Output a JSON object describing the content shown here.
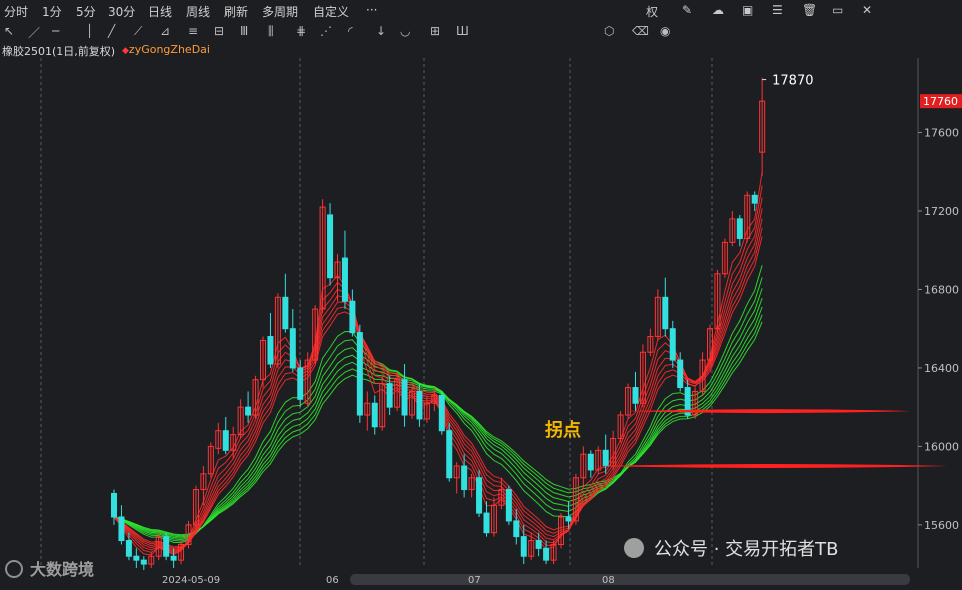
{
  "menu": [
    "分时",
    "1分",
    "5分",
    "30分",
    "日线",
    "周线",
    "刷新",
    "多周期",
    "自定义",
    "···"
  ],
  "right_tools": {
    "quan": "权",
    "icons": [
      "pencil-icon",
      "cloud-download-icon",
      "image-icon",
      "sliders-icon",
      "trash-icon",
      "layout-icon",
      "close-icon"
    ]
  },
  "drawing_tools": [
    "cursor-icon",
    "line-icon",
    "hline-icon",
    "vline-icon",
    "ray-icon",
    "segment-icon",
    "trend-angle-icon",
    "channel-icon",
    "parallel-icon",
    "period-icon",
    "fib-icon",
    "gann-icon",
    "fan-icon",
    "arc-icon",
    "down-arrow-icon",
    "cycle-icon",
    "grid-icon",
    "percent-icon",
    "shape-icon",
    "eraser-icon",
    "eye-icon"
  ],
  "info": {
    "symbol": "橡胶2501(1日,前复权)",
    "indicator": "zyGongZheDai"
  },
  "annotations": {
    "inflection": "拐点",
    "peak_label": "17870"
  },
  "watermark": {
    "left": "大数跨境",
    "right": "公众号 · 交易开拓者TB"
  },
  "colors": {
    "up": "#ff3333",
    "down": "#33e0e0",
    "ribbon_red": "#ff2a2a",
    "ribbon_green": "#33ff33",
    "price_tag": "#e02020",
    "annotation": "#f2b705"
  },
  "chart_data": {
    "type": "candlestick",
    "instrument": "橡胶2501",
    "period": "1日",
    "yticks": [
      15600,
      16000,
      16400,
      16800,
      17200,
      17600
    ],
    "ylim": [
      15380,
      17980
    ],
    "last_price": 17760,
    "high": 17870,
    "xlabels": [
      "2024-05-09",
      "06",
      "07",
      "08"
    ],
    "horizontal_lines": [
      16180,
      15900
    ],
    "candles": [
      [
        15760,
        15780,
        15600,
        15640
      ],
      [
        15640,
        15700,
        15500,
        15520
      ],
      [
        15520,
        15560,
        15420,
        15440
      ],
      [
        15440,
        15480,
        15380,
        15420
      ],
      [
        15420,
        15440,
        15360,
        15400
      ],
      [
        15400,
        15460,
        15380,
        15440
      ],
      [
        15440,
        15560,
        15420,
        15540
      ],
      [
        15540,
        15560,
        15420,
        15440
      ],
      [
        15440,
        15480,
        15380,
        15420
      ],
      [
        15420,
        15520,
        15400,
        15500
      ],
      [
        15500,
        15620,
        15480,
        15600
      ],
      [
        15600,
        15800,
        15580,
        15780
      ],
      [
        15780,
        15900,
        15700,
        15860
      ],
      [
        15860,
        16020,
        15840,
        16000
      ],
      [
        15990,
        16120,
        15960,
        16080
      ],
      [
        16080,
        16150,
        15960,
        15980
      ],
      [
        15980,
        16100,
        15940,
        16060
      ],
      [
        16060,
        16240,
        16040,
        16200
      ],
      [
        16200,
        16280,
        16120,
        16160
      ],
      [
        16160,
        16360,
        16140,
        16340
      ],
      [
        16340,
        16560,
        16300,
        16540
      ],
      [
        16560,
        16680,
        16400,
        16420
      ],
      [
        16420,
        16780,
        16400,
        16760
      ],
      [
        16760,
        16880,
        16580,
        16600
      ],
      [
        16600,
        16700,
        16380,
        16400
      ],
      [
        16400,
        16440,
        16200,
        16240
      ],
      [
        16220,
        16480,
        16200,
        16440
      ],
      [
        16440,
        16720,
        16420,
        16700
      ],
      [
        16700,
        17260,
        16680,
        17220
      ],
      [
        17180,
        17240,
        16820,
        16860
      ],
      [
        16860,
        16980,
        16740,
        16940
      ],
      [
        16960,
        17100,
        16700,
        16740
      ],
      [
        16740,
        16800,
        16560,
        16580
      ],
      [
        16580,
        16620,
        16120,
        16160
      ],
      [
        16160,
        16280,
        16080,
        16220
      ],
      [
        16220,
        16260,
        16060,
        16100
      ],
      [
        16100,
        16360,
        16080,
        16320
      ],
      [
        16320,
        16360,
        16160,
        16200
      ],
      [
        16200,
        16380,
        16180,
        16340
      ],
      [
        16340,
        16420,
        16100,
        16160
      ],
      [
        16160,
        16300,
        16140,
        16280
      ],
      [
        16280,
        16320,
        16100,
        16140
      ],
      [
        16140,
        16260,
        16120,
        16220
      ],
      [
        16220,
        16300,
        16180,
        16260
      ],
      [
        16260,
        16280,
        16060,
        16080
      ],
      [
        16080,
        16120,
        15820,
        15840
      ],
      [
        15840,
        15920,
        15760,
        15900
      ],
      [
        15900,
        15960,
        15740,
        15780
      ],
      [
        15780,
        15860,
        15740,
        15840
      ],
      [
        15840,
        15880,
        15640,
        15660
      ],
      [
        15660,
        15720,
        15540,
        15560
      ],
      [
        15560,
        15740,
        15540,
        15700
      ],
      [
        15700,
        15840,
        15680,
        15780
      ],
      [
        15780,
        15800,
        15600,
        15620
      ],
      [
        15620,
        15680,
        15500,
        15540
      ],
      [
        15540,
        15600,
        15400,
        15440
      ],
      [
        15440,
        15560,
        15420,
        15520
      ],
      [
        15520,
        15560,
        15440,
        15480
      ],
      [
        15480,
        15520,
        15400,
        15420
      ],
      [
        15420,
        15520,
        15400,
        15500
      ],
      [
        15500,
        15660,
        15480,
        15640
      ],
      [
        15640,
        15720,
        15580,
        15620
      ],
      [
        15620,
        15860,
        15600,
        15840
      ],
      [
        15840,
        16000,
        15800,
        15960
      ],
      [
        15960,
        15980,
        15840,
        15880
      ],
      [
        15880,
        16000,
        15860,
        15980
      ],
      [
        15980,
        16060,
        15860,
        15900
      ],
      [
        15900,
        16080,
        15880,
        16040
      ],
      [
        16040,
        16180,
        16020,
        16160
      ],
      [
        16160,
        16320,
        16140,
        16300
      ],
      [
        16300,
        16380,
        16180,
        16220
      ],
      [
        16220,
        16520,
        16200,
        16480
      ],
      [
        16480,
        16600,
        16460,
        16560
      ],
      [
        16560,
        16800,
        16540,
        16760
      ],
      [
        16760,
        16860,
        16560,
        16600
      ],
      [
        16600,
        16640,
        16400,
        16440
      ],
      [
        16440,
        16480,
        16280,
        16300
      ],
      [
        16300,
        16340,
        16140,
        16160
      ],
      [
        16160,
        16300,
        16140,
        16280
      ],
      [
        16280,
        16480,
        16260,
        16440
      ],
      [
        16440,
        16620,
        16420,
        16600
      ],
      [
        16600,
        16900,
        16580,
        16880
      ],
      [
        16880,
        17060,
        16860,
        17040
      ],
      [
        17040,
        17200,
        17020,
        17160
      ],
      [
        17160,
        17180,
        17020,
        17060
      ],
      [
        17060,
        17300,
        17040,
        17280
      ],
      [
        17280,
        17300,
        17200,
        17240
      ],
      [
        17500,
        17880,
        17380,
        17760
      ]
    ]
  }
}
